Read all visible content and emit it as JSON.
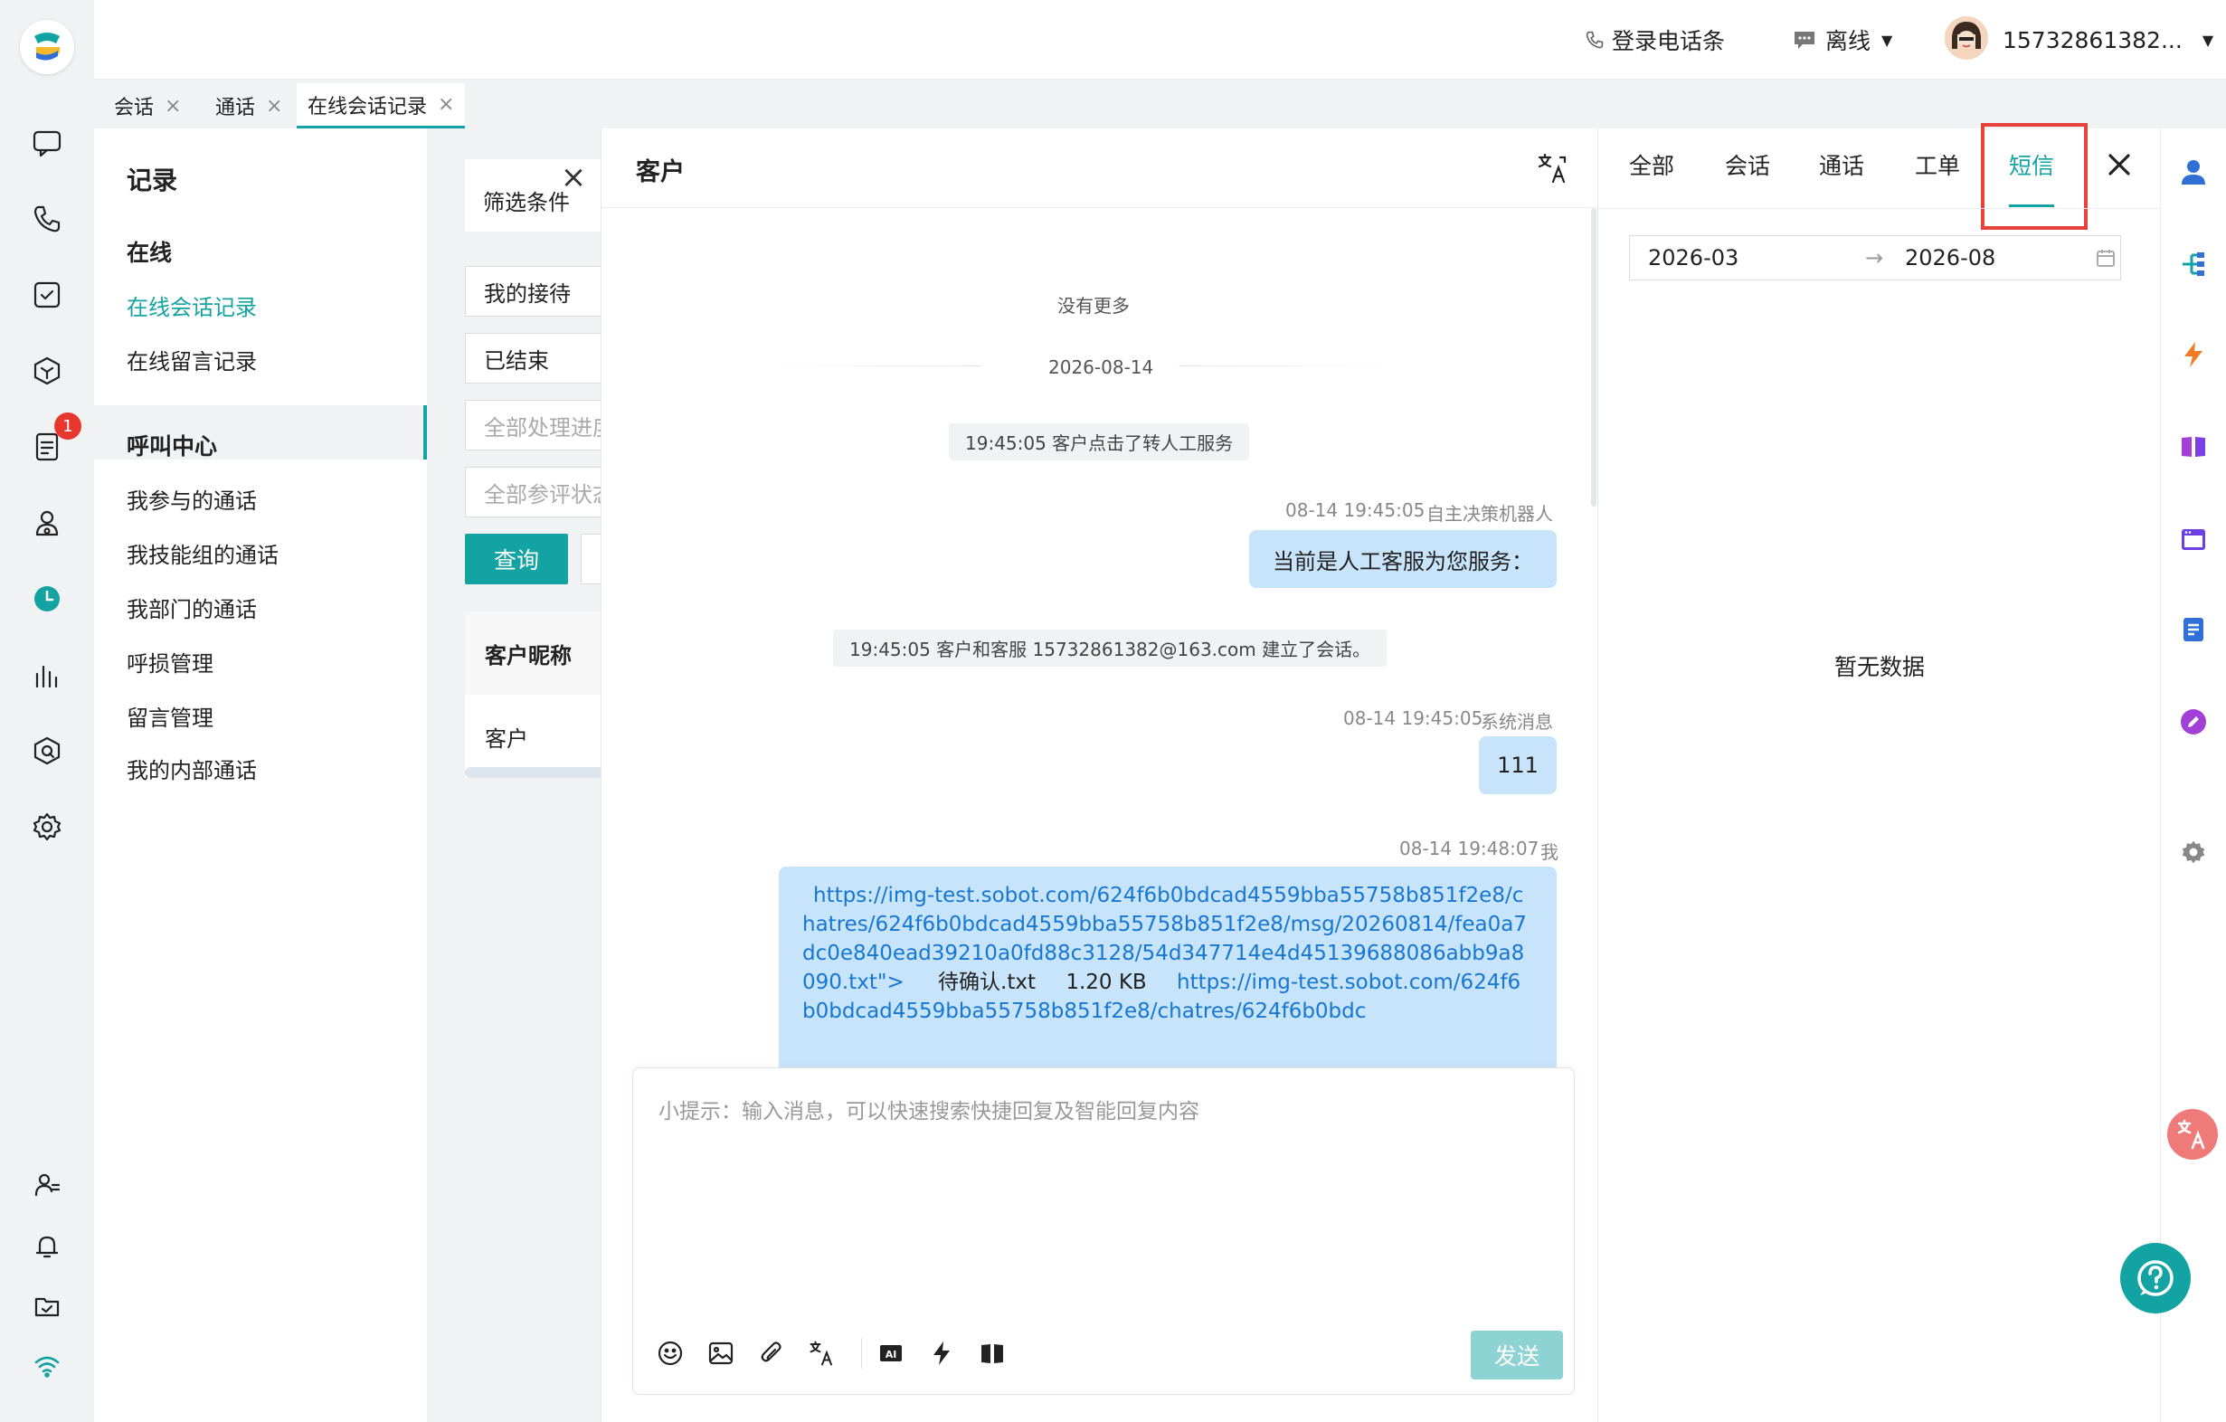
{
  "topbar": {
    "phone_bar": "登录电话条",
    "status": "离线",
    "user": "15732861382..."
  },
  "tabs": [
    {
      "label": "会话"
    },
    {
      "label": "通话"
    },
    {
      "label": "在线会话记录"
    }
  ],
  "nav": {
    "title": "记录",
    "group_online": "在线",
    "online_items": [
      "在线会话记录",
      "在线留言记录"
    ],
    "group_call": "呼叫中心",
    "call_items": [
      "我参与的通话",
      "我技能组的通话",
      "我部门的通话",
      "呼损管理",
      "留言管理",
      "我的内部通话"
    ]
  },
  "filter": {
    "header": "筛选条件",
    "reception": "我的接待",
    "state": "已结束",
    "progress_placeholder": "全部处理进度",
    "rating_placeholder": "全部参评状态",
    "query_button": "查询",
    "table_header": "客户昵称",
    "table_row": "客户"
  },
  "conversation": {
    "title": "客户",
    "no_more": "没有更多",
    "date_divider": "2026-08-14",
    "event1": "19:45:05 客户点击了转人工服务",
    "msg1_meta_time": "08-14 19:45:05",
    "msg1_meta_sender": "自主决策机器人",
    "msg1_text": "当前是人工客服为您服务：",
    "event2": "19:45:05 客户和客服 15732861382@163.com 建立了会话。",
    "msg2_meta_time": "08-14 19:45:05",
    "msg2_meta_sender": "系统消息",
    "msg2_text": "111",
    "msg3_meta_time": "08-14 19:48:07",
    "msg3_meta_sender": "我",
    "msg3_link1": "https://img-test.sobot.com/624f6b0bdcad4559bba55758b851f2e8/chatres/624f6b0bdcad4559bba55758b851f2e8/msg/20260814/fea0a7dc0e840ead39210a0fd88c3128/54d347714e4d45139688086abb9a8090.txt\">",
    "msg3_filename": "待确认.txt",
    "msg3_size": "1.20 KB",
    "msg3_link2": "https://img-test.sobot.com/624f6b0bdcad4559bba55758b851f2e8/chatres/624f6b0bdc",
    "input_placeholder": "小提示：输入消息，可以快速搜索快捷回复及智能回复内容",
    "send_button": "发送"
  },
  "right_panel": {
    "tabs": [
      "全部",
      "会话",
      "通话",
      "工单",
      "短信"
    ],
    "active_tab": "短信",
    "date_start": "2026-03",
    "date_end": "2026-08",
    "empty": "暂无数据"
  },
  "colors": {
    "accent": "#14a3a3",
    "bubble": "#c8e4fb",
    "highlight": "#e8413b",
    "badge": "#e8372f"
  },
  "badge_count": "1"
}
